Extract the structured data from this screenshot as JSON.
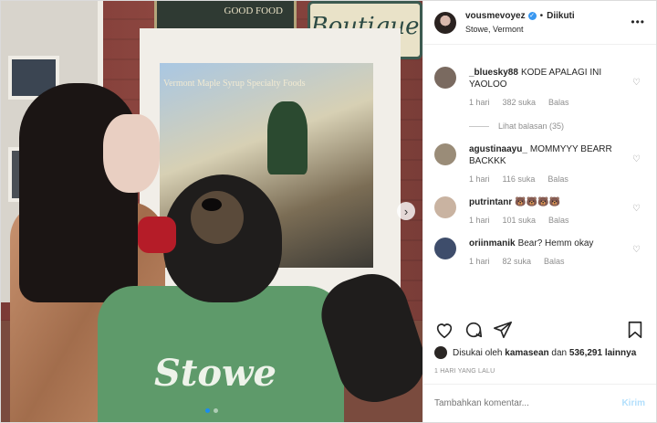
{
  "photo": {
    "sign_food": "GOOD FOOD",
    "sign_boutique": "Boutique",
    "window_text": "Vermont Maple Syrup  Specialty Foods",
    "shirt_text": "Stowe",
    "carousel_next": "›",
    "dots": 2,
    "active_dot": 0
  },
  "header": {
    "username": "vousmevoyez",
    "verified_mark": "✓",
    "separator": "•",
    "follow_status": "Diikuti",
    "location": "Stowe, Vermont",
    "more": "•••"
  },
  "comments": [
    {
      "user": "_bluesky88",
      "text": "KODE APALAGI INI YAOLOO",
      "time": "1 hari",
      "likes": "382 suka",
      "reply": "Balas",
      "avatar_color": "#7a6a60"
    },
    {
      "user": "agustinaayu_",
      "text": "MOMMYYY BEARR BACKKK",
      "time": "1 hari",
      "likes": "116 suka",
      "reply": "Balas",
      "avatar_color": "#9a8c78"
    },
    {
      "user": "putrintanr",
      "text": "🐻🐻🐻🐻",
      "time": "1 hari",
      "likes": "101 suka",
      "reply": "Balas",
      "avatar_color": "#c9b3a1"
    },
    {
      "user": "oriinmanik",
      "text": "Bear? Hemm okay",
      "time": "1 hari",
      "likes": "82 suka",
      "reply": "Balas",
      "avatar_color": "#3e4d6b"
    }
  ],
  "view_replies": "Lihat balasan (35)",
  "likes_line": {
    "prefix": "Disukai oleh",
    "user": "kamasean",
    "mid": "dan",
    "count": "536,291 lainnya"
  },
  "date": "1 HARI YANG LALU",
  "add_comment": {
    "placeholder": "Tambahkan komentar...",
    "post_label": "Kirim"
  },
  "icons": {
    "heart": "heart-icon",
    "comment": "comment-icon",
    "share": "share-icon",
    "save": "bookmark-icon"
  }
}
